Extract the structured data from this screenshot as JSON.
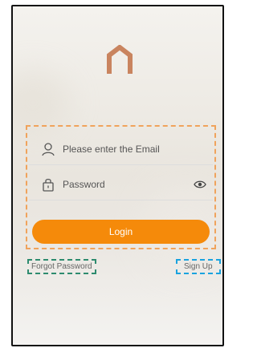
{
  "login": {
    "email_placeholder": "Please enter the Email",
    "password_placeholder": "Password",
    "login_label": "Login"
  },
  "links": {
    "forgot_password": "Forgot Password",
    "sign_up": "Sign Up"
  },
  "colors": {
    "accent": "#f58a0a",
    "logo": "#c9845f",
    "highlight_login": "#f0a35c",
    "highlight_forgot": "#2e8b6f",
    "highlight_signup": "#1aa3df"
  }
}
